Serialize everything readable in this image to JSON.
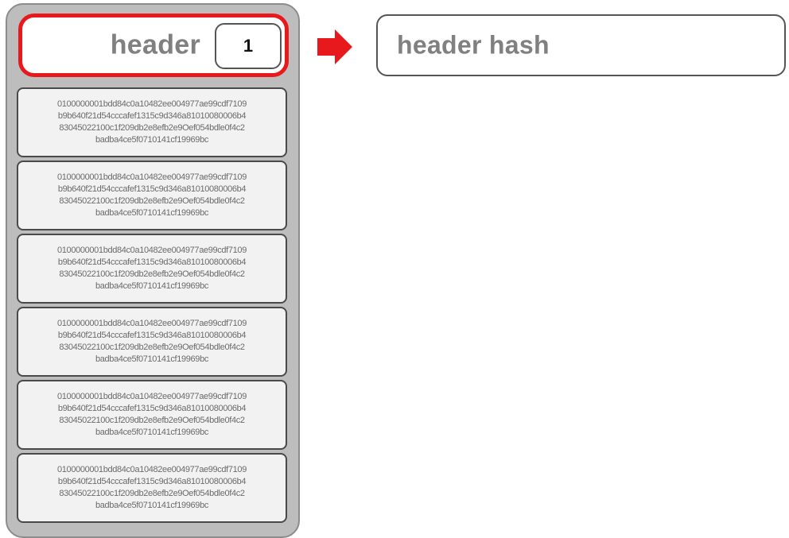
{
  "block": {
    "header": {
      "label": "header",
      "number": "1"
    },
    "transactions": [
      {
        "lines": [
          "0100000001bdd84c0a10482ee004977ae99cdf7109",
          "b9b640f21d54cccafef1315c9d346a81010080006b4",
          "83045022100c1f209db2e8efb2e9Oef054bdle0f4c2",
          "badba4ce5f0710141cf19969bc"
        ]
      },
      {
        "lines": [
          "0100000001bdd84c0a10482ee004977ae99cdf7109",
          "b9b640f21d54cccafef1315c9d346a81010080006b4",
          "83045022100c1f209db2e8efb2e9Oef054bdle0f4c2",
          "badba4ce5f0710141cf19969bc"
        ]
      },
      {
        "lines": [
          "0100000001bdd84c0a10482ee004977ae99cdf7109",
          "b9b640f21d54cccafef1315c9d346a81010080006b4",
          "83045022100c1f209db2e8efb2e9Oef054bdle0f4c2",
          "badba4ce5f0710141cf19969bc"
        ]
      },
      {
        "lines": [
          "0100000001bdd84c0a10482ee004977ae99cdf7109",
          "b9b640f21d54cccafef1315c9d346a81010080006b4",
          "83045022100c1f209db2e8efb2e9Oef054bdle0f4c2",
          "badba4ce5f0710141cf19969bc"
        ]
      },
      {
        "lines": [
          "0100000001bdd84c0a10482ee004977ae99cdf7109",
          "b9b640f21d54cccafef1315c9d346a81010080006b4",
          "83045022100c1f209db2e8efb2e9Oef054bdle0f4c2",
          "badba4ce5f0710141cf19969bc"
        ]
      },
      {
        "lines": [
          "0100000001bdd84c0a10482ee004977ae99cdf7109",
          "b9b640f21d54cccafef1315c9d346a81010080006b4",
          "83045022100c1f209db2e8efb2e9Oef054bdle0f4c2",
          "badba4ce5f0710141cf19969bc"
        ]
      }
    ]
  },
  "arrow_icon": "arrow-right-icon",
  "hash": {
    "label": "header hash"
  },
  "colors": {
    "highlight": "#e8191c",
    "block_background": "#bdbdbd",
    "text_gray": "#808080"
  }
}
